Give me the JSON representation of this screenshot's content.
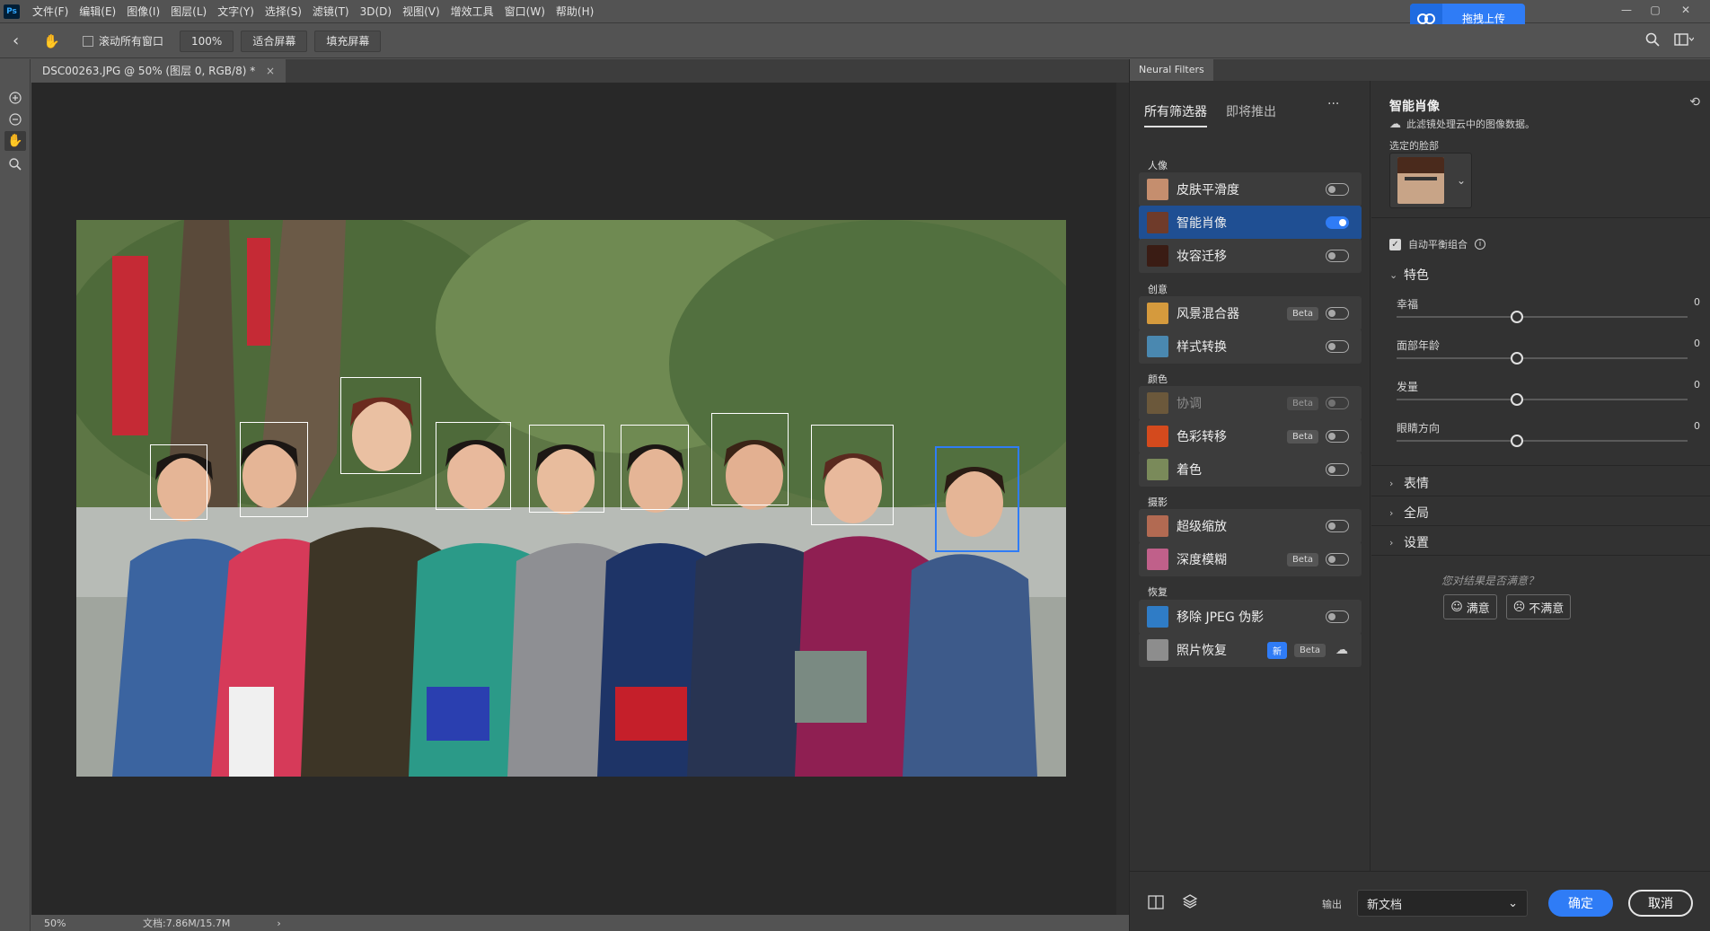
{
  "menubar": {
    "logo": "Ps",
    "items": [
      "文件(F)",
      "编辑(E)",
      "图像(I)",
      "图层(L)",
      "文字(Y)",
      "选择(S)",
      "滤镜(T)",
      "3D(D)",
      "视图(V)",
      "增效工具",
      "窗口(W)",
      "帮助(H)"
    ],
    "upload_label": "拖拽上传",
    "upload_icon": "baidu-cloud-icon"
  },
  "optionsbar": {
    "scroll_all": "滚动所有窗口",
    "zoom": "100%",
    "fit_screen": "适合屏幕",
    "fill_screen": "填充屏幕"
  },
  "document": {
    "tab_title": "DSC00263.JPG @ 50% (图层 0, RGB/8) *",
    "close": "×",
    "zoom": "50%",
    "doc_size": "文档:7.86M/15.7M",
    "status_arrow": "›"
  },
  "neural_filters": {
    "panel_title": "Neural Filters",
    "tabs": [
      "所有筛选器",
      "即将推出"
    ],
    "more": "···",
    "categories": {
      "portrait": "人像",
      "creative": "创意",
      "color": "颜色",
      "photography": "摄影",
      "restore": "恢复"
    },
    "filters": [
      {
        "name": "皮肤平滑度",
        "state": "off"
      },
      {
        "name": "智能肖像",
        "state": "on"
      },
      {
        "name": "妆容迁移",
        "state": "off"
      },
      {
        "name": "风景混合器",
        "badge": "Beta",
        "state": "off"
      },
      {
        "name": "样式转换",
        "state": "off"
      },
      {
        "name": "协调",
        "badge": "Beta",
        "state": "disabled"
      },
      {
        "name": "色彩转移",
        "badge": "Beta",
        "state": "off"
      },
      {
        "name": "着色",
        "state": "off"
      },
      {
        "name": "超级缩放",
        "state": "off"
      },
      {
        "name": "深度模糊",
        "badge": "Beta",
        "state": "off"
      },
      {
        "name": "移除 JPEG 伪影",
        "state": "off"
      },
      {
        "name": "照片恢复",
        "badge_new": "新",
        "badge": "Beta",
        "state": "download"
      }
    ],
    "settings": {
      "title": "智能肖像",
      "cloud_note": "此滤镜处理云中的图像数据。",
      "selected_face_label": "选定的脸部",
      "auto_balance": "自动平衡组合",
      "featured_section": "特色",
      "sliders": [
        {
          "label": "幸福",
          "value": "0"
        },
        {
          "label": "面部年龄",
          "value": "0"
        },
        {
          "label": "发量",
          "value": "0"
        },
        {
          "label": "眼睛方向",
          "value": "0"
        }
      ],
      "sections": [
        "表情",
        "全局",
        "设置"
      ],
      "feedback_question": "您对结果是否满意？",
      "satisfied": "满意",
      "unsatisfied": "不满意"
    },
    "footer": {
      "output_label": "输出",
      "output_value": "新文档",
      "ok": "确定",
      "cancel": "取消"
    }
  }
}
